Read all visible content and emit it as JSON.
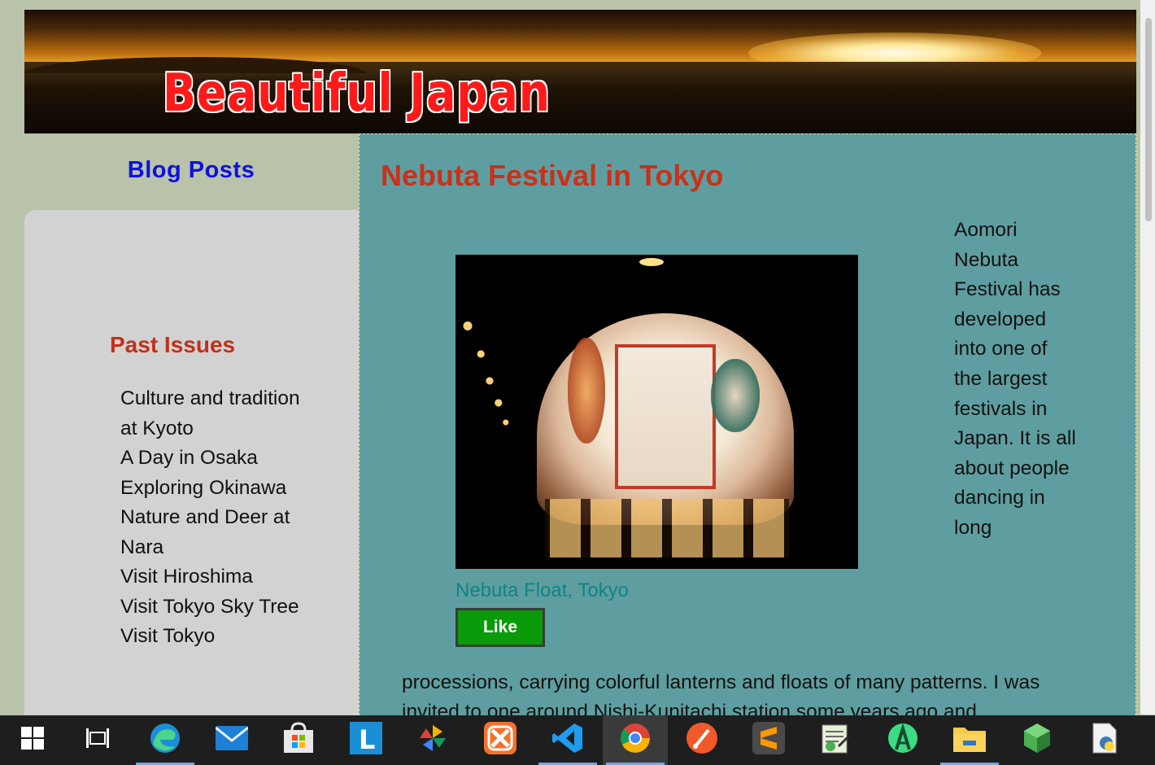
{
  "banner": {
    "title": "Beautiful Japan"
  },
  "sidebar": {
    "heading": "Blog Posts",
    "past_issues_heading": "Past Issues",
    "issues": [
      "Culture and tradition at Kyoto",
      "A Day in Osaka",
      "Exploring Okinawa",
      "Nature and Deer at Nara",
      "Visit Hiroshima",
      "Visit Tokyo Sky Tree",
      "Visit Tokyo"
    ]
  },
  "article": {
    "title": "Nebuta Festival in Tokyo",
    "figure_caption": "Nebuta Float, Tokyo",
    "like_label": "Like",
    "side_text": "Aomori Nebuta Festival has developed into one of the largest festivals in Japan. It is all about people dancing in long",
    "body_text": "processions, carrying colorful lanterns and floats of many patterns. I was invited to one around Nishi-Kunitachi station some years ago and"
  },
  "taskbar": {
    "items": [
      {
        "icon": "windows-start-icon"
      },
      {
        "icon": "task-view-icon"
      },
      {
        "icon": "edge-browser-icon"
      },
      {
        "icon": "mail-icon"
      },
      {
        "icon": "store-icon"
      },
      {
        "icon": "l-app-icon"
      },
      {
        "icon": "photos-pinwheel-icon"
      },
      {
        "icon": "xampp-icon"
      },
      {
        "icon": "vscode-icon"
      },
      {
        "icon": "chrome-icon"
      },
      {
        "icon": "paint-brush-app-icon"
      },
      {
        "icon": "sublime-text-icon"
      },
      {
        "icon": "notepad-frog-icon"
      },
      {
        "icon": "android-studio-icon"
      },
      {
        "icon": "file-explorer-icon"
      },
      {
        "icon": "green-cube-icon"
      },
      {
        "icon": "python-file-icon"
      }
    ]
  },
  "colors": {
    "page_bg": "#b8c3a9",
    "main_bg": "#5f9ea0",
    "heading_red": "#c8311a",
    "blog_posts_blue": "#1010e0",
    "caption_teal": "#0f8484",
    "like_green": "#0a9b0a"
  }
}
